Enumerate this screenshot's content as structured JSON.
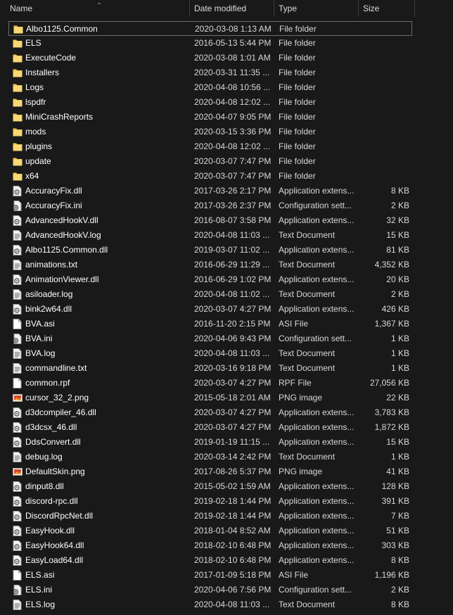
{
  "header": {
    "name": "Name",
    "date": "Date modified",
    "type": "Type",
    "size": "Size"
  },
  "colors": {
    "background": "#191919",
    "folder": "#f3c74f",
    "selection_border": "#6d6d6d"
  },
  "files": [
    {
      "name": "Albo1125.Common",
      "date": "2020-03-08 1:13 AM",
      "type": "File folder",
      "size": "",
      "icon": "folder-icon"
    },
    {
      "name": "ELS",
      "date": "2016-05-13 5:44 PM",
      "type": "File folder",
      "size": "",
      "icon": "folder-icon"
    },
    {
      "name": "ExecuteCode",
      "date": "2020-03-08 1:01 AM",
      "type": "File folder",
      "size": "",
      "icon": "folder-icon"
    },
    {
      "name": "Installers",
      "date": "2020-03-31 11:35 ...",
      "type": "File folder",
      "size": "",
      "icon": "folder-icon"
    },
    {
      "name": "Logs",
      "date": "2020-04-08 10:56 ...",
      "type": "File folder",
      "size": "",
      "icon": "folder-icon"
    },
    {
      "name": "lspdfr",
      "date": "2020-04-08 12:02 ...",
      "type": "File folder",
      "size": "",
      "icon": "folder-icon"
    },
    {
      "name": "MiniCrashReports",
      "date": "2020-04-07 9:05 PM",
      "type": "File folder",
      "size": "",
      "icon": "folder-icon"
    },
    {
      "name": "mods",
      "date": "2020-03-15 3:36 PM",
      "type": "File folder",
      "size": "",
      "icon": "folder-icon"
    },
    {
      "name": "plugins",
      "date": "2020-04-08 12:02 ...",
      "type": "File folder",
      "size": "",
      "icon": "folder-icon"
    },
    {
      "name": "update",
      "date": "2020-03-07 7:47 PM",
      "type": "File folder",
      "size": "",
      "icon": "folder-icon"
    },
    {
      "name": "x64",
      "date": "2020-03-07 7:47 PM",
      "type": "File folder",
      "size": "",
      "icon": "folder-icon"
    },
    {
      "name": "AccuracyFix.dll",
      "date": "2017-03-26 2:17 PM",
      "type": "Application extens...",
      "size": "8 KB",
      "icon": "dll-icon"
    },
    {
      "name": "AccuracyFix.ini",
      "date": "2017-03-26 2:37 PM",
      "type": "Configuration sett...",
      "size": "2 KB",
      "icon": "ini-icon"
    },
    {
      "name": "AdvancedHookV.dll",
      "date": "2016-08-07 3:58 PM",
      "type": "Application extens...",
      "size": "32 KB",
      "icon": "dll-icon"
    },
    {
      "name": "AdvancedHookV.log",
      "date": "2020-04-08 11:03 ...",
      "type": "Text Document",
      "size": "15 KB",
      "icon": "text-icon"
    },
    {
      "name": "Albo1125.Common.dll",
      "date": "2019-03-07 11:02 ...",
      "type": "Application extens...",
      "size": "81 KB",
      "icon": "dll-icon"
    },
    {
      "name": "animations.txt",
      "date": "2016-06-29 11:29 ...",
      "type": "Text Document",
      "size": "4,352 KB",
      "icon": "text-icon"
    },
    {
      "name": "AnimationViewer.dll",
      "date": "2016-06-29 1:02 PM",
      "type": "Application extens...",
      "size": "20 KB",
      "icon": "dll-icon"
    },
    {
      "name": "asiloader.log",
      "date": "2020-04-08 11:02 ...",
      "type": "Text Document",
      "size": "2 KB",
      "icon": "text-icon"
    },
    {
      "name": "bink2w64.dll",
      "date": "2020-03-07 4:27 PM",
      "type": "Application extens...",
      "size": "426 KB",
      "icon": "dll-icon"
    },
    {
      "name": "BVA.asi",
      "date": "2016-11-20 2:15 PM",
      "type": "ASI File",
      "size": "1,367 KB",
      "icon": "file-icon"
    },
    {
      "name": "BVA.ini",
      "date": "2020-04-06 9:43 PM",
      "type": "Configuration sett...",
      "size": "1 KB",
      "icon": "ini-icon"
    },
    {
      "name": "BVA.log",
      "date": "2020-04-08 11:03 ...",
      "type": "Text Document",
      "size": "1 KB",
      "icon": "text-icon"
    },
    {
      "name": "commandline.txt",
      "date": "2020-03-16 9:18 PM",
      "type": "Text Document",
      "size": "1 KB",
      "icon": "text-icon"
    },
    {
      "name": "common.rpf",
      "date": "2020-03-07 4:27 PM",
      "type": "RPF File",
      "size": "27,056 KB",
      "icon": "file-icon"
    },
    {
      "name": "cursor_32_2.png",
      "date": "2015-05-18 2:01 AM",
      "type": "PNG image",
      "size": "22 KB",
      "icon": "image-icon"
    },
    {
      "name": "d3dcompiler_46.dll",
      "date": "2020-03-07 4:27 PM",
      "type": "Application extens...",
      "size": "3,783 KB",
      "icon": "dll-icon"
    },
    {
      "name": "d3dcsx_46.dll",
      "date": "2020-03-07 4:27 PM",
      "type": "Application extens...",
      "size": "1,872 KB",
      "icon": "dll-icon"
    },
    {
      "name": "DdsConvert.dll",
      "date": "2019-01-19 11:15 ...",
      "type": "Application extens...",
      "size": "15 KB",
      "icon": "dll-icon"
    },
    {
      "name": "debug.log",
      "date": "2020-03-14 2:42 PM",
      "type": "Text Document",
      "size": "1 KB",
      "icon": "text-icon"
    },
    {
      "name": "DefaultSkin.png",
      "date": "2017-08-26 5:37 PM",
      "type": "PNG image",
      "size": "41 KB",
      "icon": "image-icon"
    },
    {
      "name": "dinput8.dll",
      "date": "2015-05-02 1:59 AM",
      "type": "Application extens...",
      "size": "128 KB",
      "icon": "dll-icon"
    },
    {
      "name": "discord-rpc.dll",
      "date": "2019-02-18 1:44 PM",
      "type": "Application extens...",
      "size": "391 KB",
      "icon": "dll-icon"
    },
    {
      "name": "DiscordRpcNet.dll",
      "date": "2019-02-18 1:44 PM",
      "type": "Application extens...",
      "size": "7 KB",
      "icon": "dll-icon"
    },
    {
      "name": "EasyHook.dll",
      "date": "2018-01-04 8:52 AM",
      "type": "Application extens...",
      "size": "51 KB",
      "icon": "dll-icon"
    },
    {
      "name": "EasyHook64.dll",
      "date": "2018-02-10 6:48 PM",
      "type": "Application extens...",
      "size": "303 KB",
      "icon": "dll-icon"
    },
    {
      "name": "EasyLoad64.dll",
      "date": "2018-02-10 6:48 PM",
      "type": "Application extens...",
      "size": "8 KB",
      "icon": "dll-icon"
    },
    {
      "name": "ELS.asi",
      "date": "2017-01-09 5:18 PM",
      "type": "ASI File",
      "size": "1,196 KB",
      "icon": "file-icon"
    },
    {
      "name": "ELS.ini",
      "date": "2020-04-06 7:56 PM",
      "type": "Configuration sett...",
      "size": "2 KB",
      "icon": "ini-icon"
    },
    {
      "name": "ELS.log",
      "date": "2020-04-08 11:03 ...",
      "type": "Text Document",
      "size": "8 KB",
      "icon": "text-icon"
    }
  ]
}
